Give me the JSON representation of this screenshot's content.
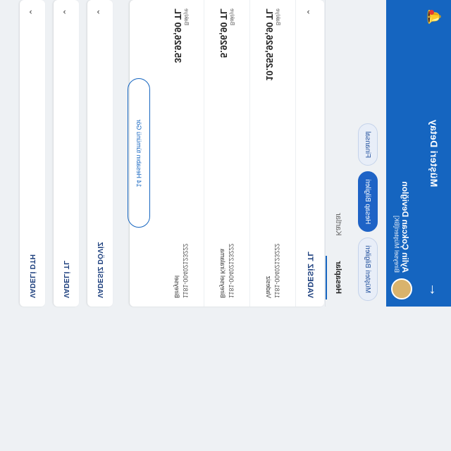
{
  "appbar": {
    "title": "Müşteri Detay",
    "back_icon": "arrow-left-icon",
    "bell_icon": "bell-icon"
  },
  "customer": {
    "name": "Aylin Çokcan Deviğlon",
    "subtitle": "Bireysel Müşteri[BK]"
  },
  "pills": [
    "Müşteri Bilgileri",
    "Hesap Bilgileri",
    "Finansal"
  ],
  "tabs": [
    "Hesaplar",
    "Kartlar"
  ],
  "account_card": {
    "name": "VADESİZ TL",
    "rows": [
      {
        "number": "1181-00402123222",
        "label": "Vadesiz",
        "small": "Bakiye",
        "amount": "10.255,926,90 TL"
      },
      {
        "number": "1181-00402123222",
        "label": "Bireysel Kiralama",
        "small": "Bakiye",
        "amount": "5.926,90 TL"
      },
      {
        "number": "1181-00402123222",
        "label": "Bireysel",
        "small": "Bakiye",
        "amount": "35.926,90 TL"
      }
    ],
    "button": "14 Hesabın tümünü Gör"
  },
  "mini_accounts": [
    "VADESİZ DÖVİZ",
    "VADELİ TL",
    "VADELİ DTH"
  ]
}
